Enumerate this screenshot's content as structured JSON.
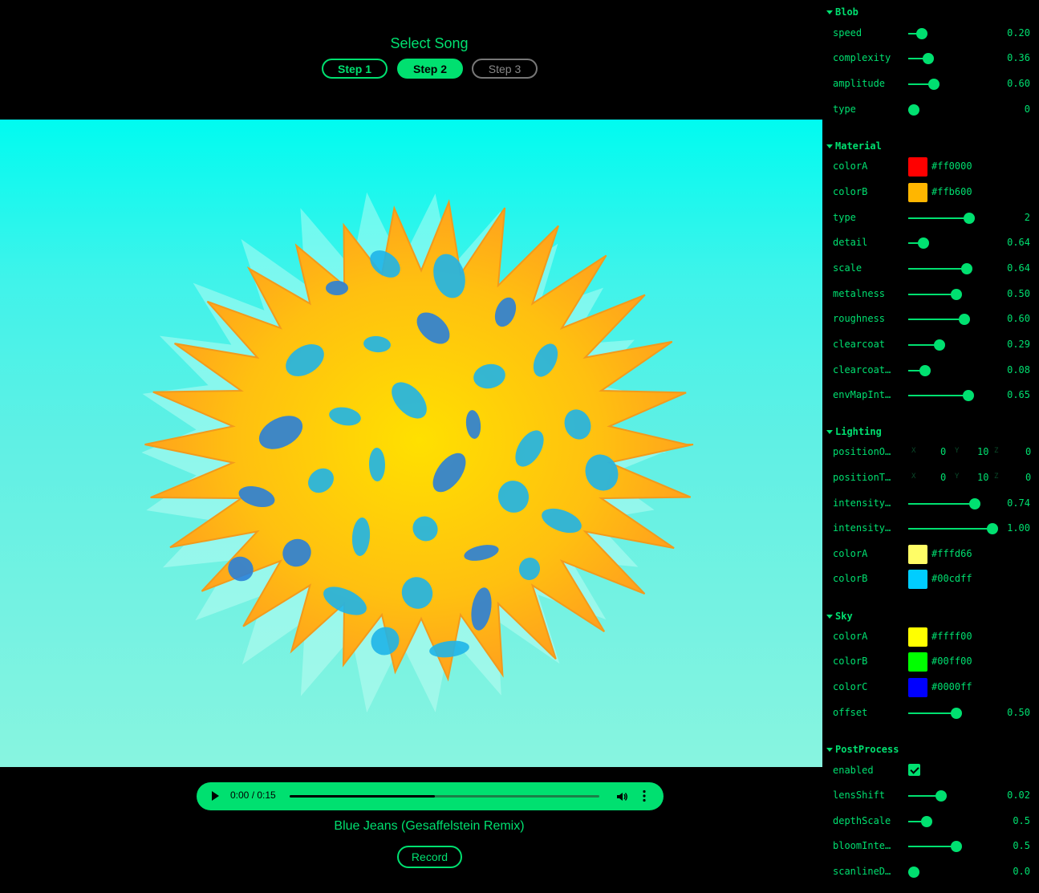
{
  "header": {
    "title": "Select Song"
  },
  "steps": [
    {
      "label": "Step 1",
      "state": "done"
    },
    {
      "label": "Step 2",
      "state": "active"
    },
    {
      "label": "Step 3",
      "state": "inactive"
    }
  ],
  "audio": {
    "time": "0:00 / 0:15",
    "progress": 0.47
  },
  "track": {
    "name": "Blue Jeans (Gesaffelstein Remix)"
  },
  "record": {
    "label": "Record"
  },
  "panel": {
    "blob": {
      "title": "Blob",
      "rows": [
        {
          "label": "speed",
          "value": "0.20",
          "level": 0.1
        },
        {
          "label": "complexity",
          "value": "0.36",
          "level": 0.18
        },
        {
          "label": "amplitude",
          "value": "0.60",
          "level": 0.26
        },
        {
          "label": "type",
          "value": "0",
          "level": 0.0
        }
      ]
    },
    "material": {
      "title": "Material",
      "colorA": {
        "label": "colorA",
        "hex": "#ff0000"
      },
      "colorB": {
        "label": "colorB",
        "hex": "#ffb600"
      },
      "rows": [
        {
          "label": "type",
          "value": "2",
          "level": 0.7
        },
        {
          "label": "detail",
          "value": "0.64",
          "level": 0.12
        },
        {
          "label": "scale",
          "value": "0.64",
          "level": 0.67
        },
        {
          "label": "metalness",
          "value": "0.50",
          "level": 0.54
        },
        {
          "label": "roughness",
          "value": "0.60",
          "level": 0.64
        },
        {
          "label": "clearcoat",
          "value": "0.29",
          "level": 0.33
        },
        {
          "label": "clearcoat…",
          "value": "0.08",
          "level": 0.14
        },
        {
          "label": "envMapInt…",
          "value": "0.65",
          "level": 0.69
        }
      ]
    },
    "lighting": {
      "title": "Lighting",
      "positionOne": {
        "label": "positionO…",
        "x": "0",
        "y": "10",
        "z": "0"
      },
      "positionTwo": {
        "label": "positionT…",
        "x": "0",
        "y": "10",
        "z": "0"
      },
      "rows": [
        {
          "label": "intensity…",
          "value": "0.74",
          "level": 0.78
        },
        {
          "label": "intensity…",
          "value": "1.00",
          "level": 1.0
        }
      ],
      "colorA": {
        "label": "colorA",
        "hex": "#fffd66"
      },
      "colorB": {
        "label": "colorB",
        "hex": "#00cdff"
      }
    },
    "sky": {
      "title": "Sky",
      "colorA": {
        "label": "colorA",
        "hex": "#ffff00"
      },
      "colorB": {
        "label": "colorB",
        "hex": "#00ff00"
      },
      "colorC": {
        "label": "colorC",
        "hex": "#0000ff"
      },
      "offset": {
        "label": "offset",
        "value": "0.50",
        "level": 0.54
      }
    },
    "postprocess": {
      "title": "PostProcess",
      "enabled": {
        "label": "enabled",
        "checked": true
      },
      "rows": [
        {
          "label": "lensShift",
          "value": "0.02",
          "level": 0.35
        },
        {
          "label": "depthScale",
          "value": "0.5",
          "level": 0.16
        },
        {
          "label": "bloomInte…",
          "value": "0.5",
          "level": 0.54
        },
        {
          "label": "scanlineD…",
          "value": "0.0",
          "level": 0.0
        }
      ]
    }
  },
  "colors": {
    "accent": "#00e070",
    "viewport_top": "#00fbf0",
    "viewport_bottom": "#88f4e0"
  }
}
